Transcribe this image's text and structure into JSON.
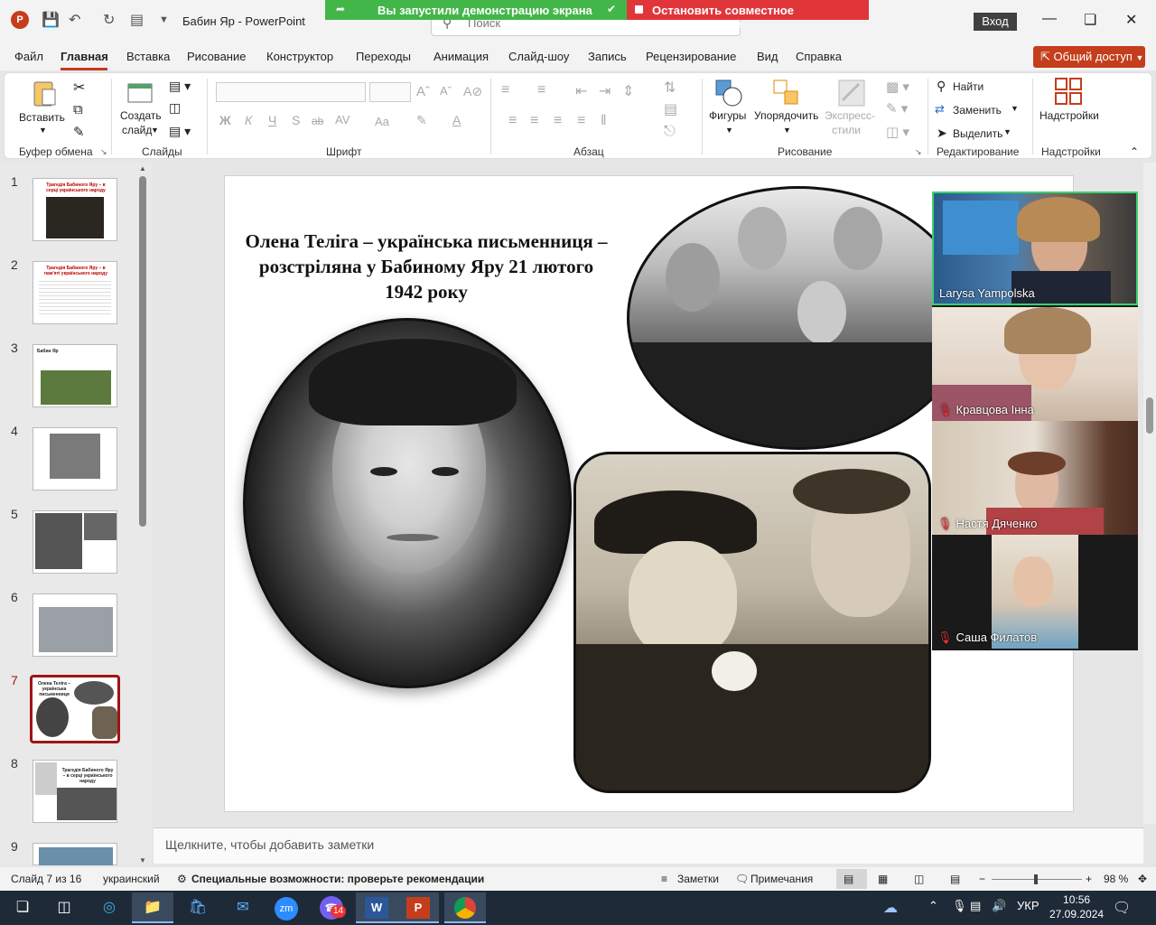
{
  "titlebar": {
    "title": "Бабин Яр  -  PowerPoint",
    "search_placeholder": "Поиск",
    "signin": "Вход",
    "share_status": "Вы запустили демонстрацию экрана",
    "stop_share": "Остановить совместное использование",
    "app_icon": "P"
  },
  "menu": {
    "tabs": [
      "Файл",
      "Главная",
      "Вставка",
      "Рисование",
      "Конструктор",
      "Переходы",
      "Анимация",
      "Слайд-шоу",
      "Запись",
      "Рецензирование",
      "Вид",
      "Справка"
    ],
    "share_button": "Общий доступ"
  },
  "ribbon": {
    "paste": "Вставить",
    "new_slide_1": "Создать",
    "new_slide_2": "слайд",
    "shapes": "Фигуры",
    "arrange": "Упорядочить",
    "quick_styles_1": "Экспресс-",
    "quick_styles_2": "стили",
    "find": "Найти",
    "replace": "Заменить",
    "select": "Выделить",
    "addins": "Надстройки",
    "bold": "Ж",
    "italic": "К",
    "underline": "Ч",
    "shadow": "S",
    "strike": "ab",
    "spacing": "AV",
    "case": "Aa",
    "font_color": "A",
    "groups": {
      "clipboard": "Буфер обмена",
      "slides": "Слайды",
      "font": "Шрифт",
      "paragraph": "Абзац",
      "drawing": "Рисование",
      "editing": "Редактирование",
      "addins": "Надстройки"
    }
  },
  "thumbnails": [
    {
      "num": "1",
      "text": "Трагедія Бабиного Яру – в серці українського народу"
    },
    {
      "num": "2",
      "text": "Трагедія Бабиного Яру – в пам'яті українського народу"
    },
    {
      "num": "3",
      "text": "Бабин Яр"
    },
    {
      "num": "4",
      "text": ""
    },
    {
      "num": "5",
      "text": ""
    },
    {
      "num": "6",
      "text": ""
    },
    {
      "num": "7",
      "text": "Олена Теліга – українська письменниця"
    },
    {
      "num": "8",
      "text": "Трагедія Бабиного Яру – в серці українського народу"
    },
    {
      "num": "9",
      "text": ""
    }
  ],
  "slide": {
    "title": "Олена Теліга – українська письменниця – розстріляна у Бабиному Яру 21 лютого 1942 року"
  },
  "notes": {
    "placeholder": "Щелкните, чтобы добавить заметки"
  },
  "status": {
    "slide_counter": "Слайд 7 из 16",
    "language": "украинский",
    "accessibility": "Специальные возможности: проверьте рекомендации",
    "notes": "Заметки",
    "comments": "Примечания",
    "zoom": "98 %"
  },
  "video": {
    "participants": [
      "Larysa Yampolska",
      "Кравцова Інна",
      "Настя Дяченко",
      "Саша Филатов"
    ]
  },
  "taskbar": {
    "zoom_label": "zm",
    "viber_badge": "14",
    "language": "УКР",
    "time": "10:56",
    "date": "27.09.2024"
  },
  "colors": {
    "accent": "#c43e1c",
    "share_green": "#43b649",
    "share_red": "#e0363a",
    "taskbar": "#1f2a38"
  }
}
